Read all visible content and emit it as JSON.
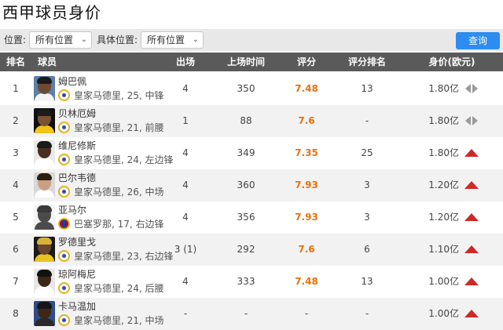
{
  "title": "西甲球员身价",
  "filters": {
    "position_label": "位置:",
    "position_value": "所有位置",
    "detail_label": "具体位置:",
    "detail_value": "所有位置",
    "query_label": "查询"
  },
  "columns": [
    "排名",
    "球员",
    "出场",
    "上场时间",
    "评分",
    "评分排名",
    "身价(欧元)"
  ],
  "colors": {
    "header_bg": "#5a5a5a",
    "rating": "#e8720b",
    "trend_up": "#cc2a2a",
    "trend_flat": "#9a9a9a",
    "button": "#2d8cf0"
  },
  "rows": [
    {
      "rank": "1",
      "name": "姆巴佩",
      "info": "皇家马德里, 25, 中锋",
      "club": "rm",
      "apps": "4",
      "minutes": "350",
      "rating": "7.48",
      "rating_rank": "13",
      "value": "1.80亿",
      "trend": "flat",
      "avatar_skin": "#6b4a34",
      "avatar_hair": "#1b1b1b",
      "avatar_kit": "#f4f4f4",
      "avatar_bg": "#5d7fa8"
    },
    {
      "rank": "2",
      "name": "贝林厄姆",
      "info": "皇家马德里, 21, 前腰",
      "club": "rm",
      "apps": "1",
      "minutes": "88",
      "rating": "7.6",
      "rating_rank": "-",
      "value": "1.80亿",
      "trend": "flat",
      "avatar_skin": "#7a5236",
      "avatar_hair": "#1b1b1b",
      "avatar_kit": "#f0c419",
      "avatar_bg": "#101010"
    },
    {
      "rank": "3",
      "name": "维尼修斯",
      "info": "皇家马德里, 24, 左边锋",
      "club": "rm",
      "apps": "4",
      "minutes": "349",
      "rating": "7.35",
      "rating_rank": "25",
      "value": "1.80亿",
      "trend": "up",
      "avatar_skin": "#4a2f20",
      "avatar_hair": "#1a1a1a",
      "avatar_kit": "#ffffff",
      "avatar_bg": "#e9e9e9"
    },
    {
      "rank": "4",
      "name": "巴尔韦德",
      "info": "皇家马德里, 26, 中场",
      "club": "rm",
      "apps": "4",
      "minutes": "360",
      "rating": "7.93",
      "rating_rank": "3",
      "value": "1.20亿",
      "trend": "up",
      "avatar_skin": "#c9a081",
      "avatar_hair": "#2a1d14",
      "avatar_kit": "#ffffff",
      "avatar_bg": "#d8d8d8"
    },
    {
      "rank": "5",
      "name": "亚马尔",
      "info": "巴塞罗那, 17, 右边锋",
      "club": "fcb",
      "apps": "4",
      "minutes": "356",
      "rating": "7.93",
      "rating_rank": "3",
      "value": "1.20亿",
      "trend": "up",
      "avatar_skin": "#4b4b4b",
      "avatar_hair": "#3a3a3a",
      "avatar_kit": "#4b4b4b",
      "avatar_bg": "#f4f4f4"
    },
    {
      "rank": "6",
      "name": "罗德里戈",
      "info": "皇家马德里, 23, 右边锋",
      "club": "rm",
      "apps": "3 (1)",
      "minutes": "292",
      "rating": "7.6",
      "rating_rank": "6",
      "value": "1.10亿",
      "trend": "up",
      "avatar_skin": "#6a4530",
      "avatar_hair": "#d9b13a",
      "avatar_kit": "#e8c21e",
      "avatar_bg": "#1a1a1a"
    },
    {
      "rank": "7",
      "name": "琼阿梅尼",
      "info": "皇家马德里, 24, 后腰",
      "club": "rm",
      "apps": "4",
      "minutes": "333",
      "rating": "7.48",
      "rating_rank": "13",
      "value": "1.00亿",
      "trend": "up",
      "avatar_skin": "#3d261a",
      "avatar_hair": "#121212",
      "avatar_kit": "#ffffff",
      "avatar_bg": "#e6e6e6"
    },
    {
      "rank": "8",
      "name": "卡马温加",
      "info": "皇家马德里, 21, 中场",
      "club": "rm",
      "apps": "-",
      "minutes": "-",
      "rating": "-",
      "rating_rank": "-",
      "value": "1.00亿",
      "trend": "up",
      "avatar_skin": "#3e2719",
      "avatar_hair": "#151515",
      "avatar_kit": "#2a2a2a",
      "avatar_bg": "#2e4c8a"
    }
  ]
}
